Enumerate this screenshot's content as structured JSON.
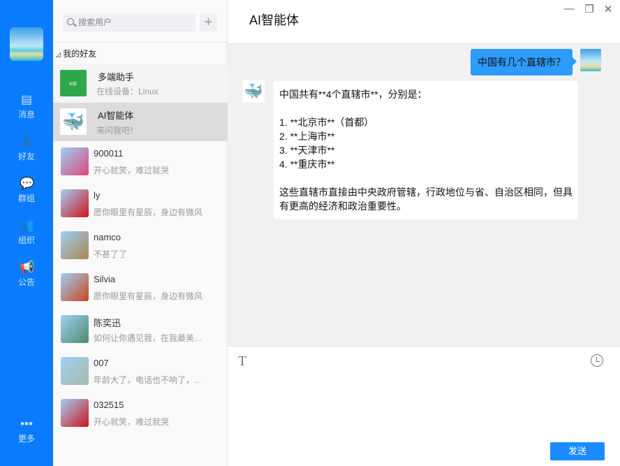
{
  "nav": {
    "items": [
      {
        "label": "消息",
        "icon": "message-icon"
      },
      {
        "label": "好友",
        "icon": "friends-icon"
      },
      {
        "label": "群组",
        "icon": "group-icon"
      },
      {
        "label": "组织",
        "icon": "organization-icon"
      },
      {
        "label": "公告",
        "icon": "announcement-icon"
      }
    ],
    "more": "更多"
  },
  "contacts": {
    "search_placeholder": "搜索用户",
    "add": "+",
    "group": "我的好友",
    "group_toggle": "◿",
    "pinned": [
      {
        "name": "多端助手",
        "status": "在线设备：Linux"
      },
      {
        "name": "AI智能体",
        "status": "来问我吧！"
      }
    ],
    "friends": [
      {
        "name": "900011",
        "status": "开心就笑，难过就哭",
        "color": "#d9487a"
      },
      {
        "name": "ly",
        "status": "愿你眼里有星辰，身边有微风",
        "color": "#d0141c"
      },
      {
        "name": "namco",
        "status": "不甚了了",
        "color": "#a7864f"
      },
      {
        "name": "Silvia",
        "status": "愿你眼里有星辰，身边有微风",
        "color": "#c9461e"
      },
      {
        "name": "陈奕迅",
        "status": "如何让你遇见我，在我最美丽的时刻",
        "color": "#4f8a6b"
      },
      {
        "name": "007",
        "status": "年龄大了，电话也不响了，...",
        "color": "#a9b9a8"
      },
      {
        "name": "032515",
        "status": "开心就笑，难过就哭",
        "color": "#d0141c"
      }
    ]
  },
  "chat": {
    "title": "AI智能体",
    "user_message": "中国有几个直辖市？",
    "ai_message": "中国共有**4个直辖市**，分别是：\n\n1. **北京市**（首都）\n2. **上海市**\n3. **天津市**\n4. **重庆市**\n\n这些直辖市直接由中央政府管辖，行政地位与省、自治区相同，但具有更高的经济和政治重要性。",
    "send": "发送",
    "font_tool": "T"
  },
  "colors": {
    "nav": "#0a7cff",
    "user_bubble": "#2d9bff",
    "send": "#1a8cff"
  }
}
